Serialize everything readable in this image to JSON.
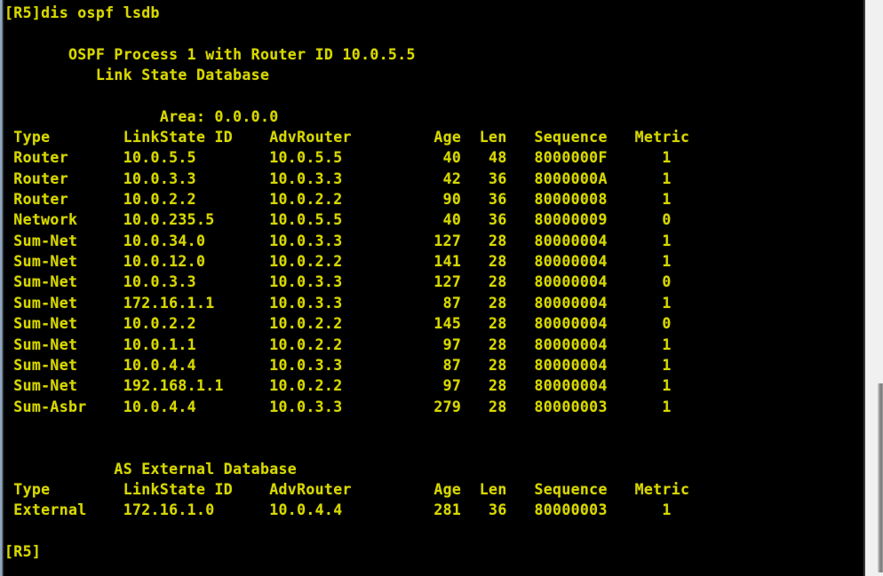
{
  "window": {
    "title": "Terminal",
    "text_color": "#d7d700",
    "background_color": "#000000"
  },
  "scrollbar": {
    "name": "vertical-scrollbar",
    "track_color": "#f0f0f0",
    "thumb_color": "#8e8e8e"
  },
  "terminal": {
    "prompt": "[R5]",
    "command": "dis ospf lsdb",
    "command_line": "[R5]dis ospf lsdb",
    "trailing_prompt": "[R5]",
    "header": {
      "process_line": "       OSPF Process 1 with Router ID 10.0.5.5",
      "database_line": "          Link State Database",
      "process_id": "1",
      "router_id": "10.0.5.5",
      "database_title": "Link State Database"
    },
    "area": {
      "label": "Area:",
      "value": "0.0.0.0",
      "line": "                 Area: 0.0.0.0"
    },
    "columns": [
      "Type",
      "LinkState ID",
      "AdvRouter",
      "Age",
      "Len",
      "Sequence",
      "Metric"
    ],
    "lsdb_header_line": " Type        LinkState ID    AdvRouter        Age  Len   Sequence   Metric",
    "lsdb_rows": [
      {
        "type": "Router",
        "linkstate_id": "10.0.5.5",
        "advrouter": "10.0.5.5",
        "age": "40",
        "len": "48",
        "sequence": "8000000F",
        "metric": "1"
      },
      {
        "type": "Router",
        "linkstate_id": "10.0.3.3",
        "advrouter": "10.0.3.3",
        "age": "42",
        "len": "36",
        "sequence": "8000000A",
        "metric": "1"
      },
      {
        "type": "Router",
        "linkstate_id": "10.0.2.2",
        "advrouter": "10.0.2.2",
        "age": "90",
        "len": "36",
        "sequence": "80000008",
        "metric": "1"
      },
      {
        "type": "Network",
        "linkstate_id": "10.0.235.5",
        "advrouter": "10.0.5.5",
        "age": "40",
        "len": "36",
        "sequence": "80000009",
        "metric": "0"
      },
      {
        "type": "Sum-Net",
        "linkstate_id": "10.0.34.0",
        "advrouter": "10.0.3.3",
        "age": "127",
        "len": "28",
        "sequence": "80000004",
        "metric": "1"
      },
      {
        "type": "Sum-Net",
        "linkstate_id": "10.0.12.0",
        "advrouter": "10.0.2.2",
        "age": "141",
        "len": "28",
        "sequence": "80000004",
        "metric": "1"
      },
      {
        "type": "Sum-Net",
        "linkstate_id": "10.0.3.3",
        "advrouter": "10.0.3.3",
        "age": "127",
        "len": "28",
        "sequence": "80000004",
        "metric": "0"
      },
      {
        "type": "Sum-Net",
        "linkstate_id": "172.16.1.1",
        "advrouter": "10.0.3.3",
        "age": "87",
        "len": "28",
        "sequence": "80000004",
        "metric": "1"
      },
      {
        "type": "Sum-Net",
        "linkstate_id": "10.0.2.2",
        "advrouter": "10.0.2.2",
        "age": "145",
        "len": "28",
        "sequence": "80000004",
        "metric": "0"
      },
      {
        "type": "Sum-Net",
        "linkstate_id": "10.0.1.1",
        "advrouter": "10.0.2.2",
        "age": "97",
        "len": "28",
        "sequence": "80000004",
        "metric": "1"
      },
      {
        "type": "Sum-Net",
        "linkstate_id": "10.0.4.4",
        "advrouter": "10.0.3.3",
        "age": "87",
        "len": "28",
        "sequence": "80000004",
        "metric": "1"
      },
      {
        "type": "Sum-Net",
        "linkstate_id": "192.168.1.1",
        "advrouter": "10.0.2.2",
        "age": "97",
        "len": "28",
        "sequence": "80000004",
        "metric": "1"
      },
      {
        "type": "Sum-Asbr",
        "linkstate_id": "10.0.4.4",
        "advrouter": "10.0.3.3",
        "age": "279",
        "len": "28",
        "sequence": "80000003",
        "metric": "1"
      }
    ],
    "external": {
      "title": "AS External Database",
      "title_line": "            AS External Database",
      "header_line": " Type        LinkState ID    AdvRouter        Age  Len   Sequence   Metric",
      "rows": [
        {
          "type": "External",
          "linkstate_id": "172.16.1.0",
          "advrouter": "10.0.4.4",
          "age": "281",
          "len": "36",
          "sequence": "80000003",
          "metric": "1"
        }
      ]
    },
    "lines": [
      "[R5]dis ospf lsdb",
      "",
      "       OSPF Process 1 with Router ID 10.0.5.5",
      "          Link State Database",
      "",
      "                 Area: 0.0.0.0",
      " Type        LinkState ID    AdvRouter         Age  Len   Sequence   Metric",
      " Router      10.0.5.5        10.0.5.5           40   48   8000000F      1",
      " Router      10.0.3.3        10.0.3.3           42   36   8000000A      1",
      " Router      10.0.2.2        10.0.2.2           90   36   80000008      1",
      " Network     10.0.235.5      10.0.5.5           40   36   80000009      0",
      " Sum-Net     10.0.34.0       10.0.3.3          127   28   80000004      1",
      " Sum-Net     10.0.12.0       10.0.2.2          141   28   80000004      1",
      " Sum-Net     10.0.3.3        10.0.3.3          127   28   80000004      0",
      " Sum-Net     172.16.1.1      10.0.3.3           87   28   80000004      1",
      " Sum-Net     10.0.2.2        10.0.2.2          145   28   80000004      0",
      " Sum-Net     10.0.1.1        10.0.2.2           97   28   80000004      1",
      " Sum-Net     10.0.4.4        10.0.3.3           87   28   80000004      1",
      " Sum-Net     192.168.1.1     10.0.2.2           97   28   80000004      1",
      " Sum-Asbr    10.0.4.4        10.0.3.3          279   28   80000003      1",
      "",
      "",
      "            AS External Database",
      " Type        LinkState ID    AdvRouter         Age  Len   Sequence   Metric",
      " External    172.16.1.0      10.0.4.4          281   36   80000003      1",
      "",
      "[R5]"
    ]
  }
}
